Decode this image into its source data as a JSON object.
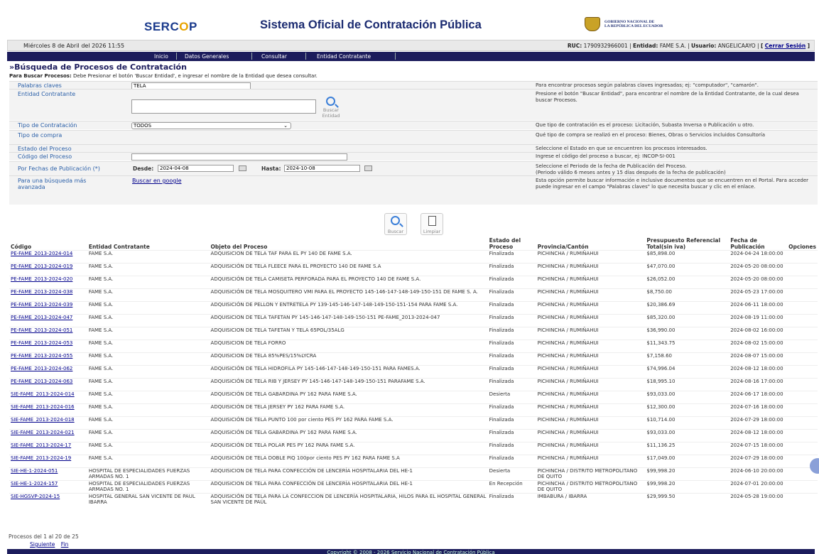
{
  "header": {
    "logo_text": "SERC",
    "logo_o": "O",
    "logo_tail": "P",
    "title": "Sistema Oficial de Contratación Pública",
    "gov_line1": "GOBIERNO NACIONAL DE",
    "gov_line2": "LA REPÚBLICA DEL ECUADOR"
  },
  "datebar": {
    "date": "Miércoles 8 de Abril del 2026 11:55",
    "ruc_label": "RUC:",
    "ruc": "1790932966001",
    "entidad_label": "Entidad:",
    "entidad": "FAME S.A.",
    "usuario_label": "Usuario:",
    "usuario": "ANGELICAAYO",
    "logout": "Cerrar Sesión"
  },
  "nav": [
    "Inicio",
    "Datos Generales",
    "Consultar",
    "Entidad Contratante"
  ],
  "page": {
    "title": "»Búsqueda de Procesos de Contratación",
    "instr_bold": "Para Buscar Procesos:",
    "instr": "Debe Presionar el botón 'Buscar Entidad', e ingresar el nombre de la Entidad que desea consultar."
  },
  "form": {
    "palabras": {
      "label": "Palabras claves",
      "value": "TELA",
      "help": "Para encontrar procesos según palabras claves ingresadas; ej: \"computador\", \"camarón\"."
    },
    "entidad": {
      "label": "Entidad Contratante",
      "value": "",
      "help": "Presione el botón \"Buscar Entidad\", para encontrar el nombre de la Entidad Contratante, de la cual desea buscar Procesos.",
      "btn1": "Buscar",
      "btn2": "Entidad"
    },
    "tipo": {
      "label": "Tipo de Contratación",
      "value": "TODOS",
      "help": "Que tipo de contratación es el proceso: Licitación, Subasta Inversa o Publicación u otro."
    },
    "compra": {
      "label": "Tipo de compra",
      "help": "Qué tipo de compra se realizó en el proceso: Bienes, Obras o Servicios incluidos Consultoría"
    },
    "estado": {
      "label": "Estado del Proceso",
      "help": "Seleccione el Estado en que se encuentren los procesos interesados."
    },
    "codigo": {
      "label": "Código del Proceso",
      "value": "",
      "help": "Ingrese el código del proceso a buscar, ej: INCOP-SI-001"
    },
    "fechas": {
      "label": "Por Fechas de Publicación (*)",
      "desde_label": "Desde:",
      "desde": "2024-04-08",
      "hasta_label": "Hasta:",
      "hasta": "2024-10-08",
      "help1": "Seleccione el Periodo de la fecha de Publicación del Proceso.",
      "help2": "(Periodo válido 6 meses antes y 15 días después de la fecha de publicación)"
    },
    "avanzada": {
      "label1": "Para una búsqueda más",
      "label2": "avanzada",
      "link": "Buscar en google",
      "help": "Esta opción permite buscar información e inclusive documentos que se encuentren en el Portal. Para acceder puede ingresar en el campo \"Palabras claves\" lo que necesita buscar y clic en el enlace."
    }
  },
  "actions": {
    "buscar": "Buscar",
    "limpiar": "Limpiar"
  },
  "table": {
    "headers": [
      "Código",
      "Entidad Contratante",
      "Objeto del Proceso",
      "Estado del Proceso",
      "Provincia/Cantón",
      "Presupuesto Referencial Total(sin iva)",
      "Fecha de Publicación",
      "Opciones"
    ],
    "rows": [
      [
        "PE-FAME_2013-2024-014",
        "FAME S.A.",
        "ADQUISICION DE TELA TAF PARA EL PY 140 DE FAME S.A.",
        "Finalizada",
        "PICHINCHA / RUMIÑAHUI",
        "$85,898.00",
        "2024-04-24 18:00:00"
      ],
      [
        "PE-FAME_2013-2024-019",
        "FAME S.A.",
        "ADQUISICIÓN DE TELA FLEECE PARA EL PROYECTO 140 DE FAME S.A",
        "Finalizada",
        "PICHINCHA / RUMIÑAHUI",
        "$47,070.00",
        "2024-05-20 08:00:00"
      ],
      [
        "PE-FAME_2013-2024-020",
        "FAME S.A.",
        "ADQUISICIÓN DE TELA CAMISETA PERFORADA PARA EL PROYECTO 140 DE FAME S.A.",
        "Finalizada",
        "PICHINCHA / RUMIÑAHUI",
        "$26,052.00",
        "2024-05-20 08:00:00"
      ],
      [
        "PE-FAME_2013-2024-038",
        "FAME S.A.",
        "ADQUISICIÓN DE TELA MOSQUITERO VMI PARA EL PROYECTO 145-146-147-148-149-150-151 DE FAME S. A.",
        "Finalizada",
        "PICHINCHA / RUMIÑAHUI",
        "$8,750.00",
        "2024-05-23 17:00:00"
      ],
      [
        "PE-FAME_2013-2024-039",
        "FAME S.A.",
        "ADQUISICIÓN DE PELLON Y ENTRETELA PY 139-145-146-147-148-149-150-151-154 PARA FAME S.A.",
        "Finalizada",
        "PICHINCHA / RUMIÑAHUI",
        "$20,386.69",
        "2024-06-11 18:00:00"
      ],
      [
        "PE-FAME_2013-2024-047",
        "FAME S.A.",
        "ADQUISICION DE TELA TAFETAN PY 145-146-147-148-149-150-151 PE-FAME_2013-2024-047",
        "Finalizada",
        "PICHINCHA / RUMIÑAHUI",
        "$85,320.00",
        "2024-08-19 11:00:00"
      ],
      [
        "PE-FAME_2013-2024-051",
        "FAME S.A.",
        "ADQUISICION DE TELA TAFETAN Y TELA 65POL/35ALG",
        "Finalizada",
        "PICHINCHA / RUMIÑAHUI",
        "$36,990.00",
        "2024-08-02 16:00:00"
      ],
      [
        "PE-FAME_2013-2024-053",
        "FAME S.A.",
        "ADQUISICION DE TELA FORRO",
        "Finalizada",
        "PICHINCHA / RUMIÑAHUI",
        "$11,343.75",
        "2024-08-02 15:00:00"
      ],
      [
        "PE-FAME_2013-2024-055",
        "FAME S.A.",
        "ADQUISICION DE TELA 85%PES/15%LYCRA",
        "Finalizada",
        "PICHINCHA / RUMIÑAHUI",
        "$7,158.60",
        "2024-08-07 15:00:00"
      ],
      [
        "PE-FAME_2013-2024-062",
        "FAME S.A.",
        "ADQUISICIÓN DE TELA HIDROFILA PY 145-146-147-148-149-150-151 PARA FAMES.A.",
        "Finalizada",
        "PICHINCHA / RUMIÑAHUI",
        "$74,996.04",
        "2024-08-12 18:00:00"
      ],
      [
        "PE-FAME_2013-2024-063",
        "FAME S.A.",
        "ADQUISICIÓN DE TELA RIB Y JERSEY PY 145-146-147-148-149-150-151 PARAFAME S.A.",
        "Finalizada",
        "PICHINCHA / RUMIÑAHUI",
        "$18,995.10",
        "2024-08-16 17:00:00"
      ],
      [
        "SIE-FAME_2013-2024-014",
        "FAME S.A.",
        "ADQUISICIÓN DE TELA GABARDINA PY 162 PARA FAME S.A.",
        "Desierta",
        "PICHINCHA / RUMIÑAHUI",
        "$93,033.00",
        "2024-06-17 18:00:00"
      ],
      [
        "SIE-FAME_2013-2024-016",
        "FAME S.A.",
        "ADQUISICIÓN DE TELA JERSEY PY 162 PARA FAME S.A.",
        "Finalizada",
        "PICHINCHA / RUMIÑAHUI",
        "$12,300.00",
        "2024-07-16 18:00:00"
      ],
      [
        "SIE-FAME_2013-2024-018",
        "FAME S.A.",
        "ADQUISICIÓN DE TELA PUNTO 100 por ciento PES PY 162 PARA FAME S.A.",
        "Finalizada",
        "PICHINCHA / RUMIÑAHUI",
        "$10,714.00",
        "2024-07-29 18:00:00"
      ],
      [
        "SIE-FAME_2013-2024-021",
        "FAME S.A.",
        "ADQUISICIÓN DE TELA GABARDINA PY 162 PARA FAME S.A.",
        "Finalizada",
        "PICHINCHA / RUMIÑAHUI",
        "$93,033.00",
        "2024-08-12 18:00:00"
      ],
      [
        "SIE-FAME_2013-2024-17",
        "FAME S.A.",
        "ADQUISICIÓN DE TELA POLAR PES PY 162 PARA FAME S.A.",
        "Finalizada",
        "PICHINCHA / RUMIÑAHUI",
        "$11,136.25",
        "2024-07-15 18:00:00"
      ],
      [
        "SIE-FAME_2013-2024-19",
        "FAME S.A.",
        "ADQUISICIÓN DE TELA DOBLE PIQ 100por ciento PES PY 162 PARA FAME S.A",
        "Finalizada",
        "PICHINCHA / RUMIÑAHUI",
        "$17,049.00",
        "2024-07-29 18:00:00"
      ],
      [
        "SIE-HE-1-2024-051",
        "HOSPITAL DE ESPECIALIDADES FUERZAS ARMADAS NO. 1",
        "ADQUISICION DE TELA PARA CONFECCIÓN DE LENCERÍA HOSPITALARIA DEL HE-1",
        "Desierta",
        "PICHINCHA / DISTRITO METROPOLITANO DE QUITO",
        "$99,998.20",
        "2024-06-10 20:00:00"
      ],
      [
        "SIE-HE-1-2024-157",
        "HOSPITAL DE ESPECIALIDADES FUERZAS ARMADAS NO. 1",
        "ADQUISICION DE TELA PARA CONFECCIÓN DE LENCERÍA HOSPITALARIA DEL HE-1",
        "En Recepción",
        "PICHINCHA / DISTRITO METROPOLITANO DE QUITO",
        "$99,998.20",
        "2024-07-01 20:00:00"
      ],
      [
        "SIE-HGSVP-2024-15",
        "HOSPITAL GENERAL SAN VICENTE DE PAUL IBARRA",
        "ADQUISICIÓN DE TELA PARA LA CONFECCION DE LENCERÍA HOSPITALARIA, HILOS PARA EL HOSPITAL GENERAL SAN VICENTE DE PAÚL",
        "Finalizada",
        "IMBABURA / IBARRA",
        "$29,999.50",
        "2024-05-28 19:00:00"
      ]
    ]
  },
  "footer": {
    "count": "Procesos del 1 al 20 de 25",
    "next": "Siguiente",
    "last": "Fin",
    "copyright": "Copyright © 2008 - 2026 Servicio Nacional de Contratación Pública"
  },
  "colors": {
    "nav": "#1c1c5c",
    "link": "#00008b",
    "label": "#2a5fa8"
  }
}
